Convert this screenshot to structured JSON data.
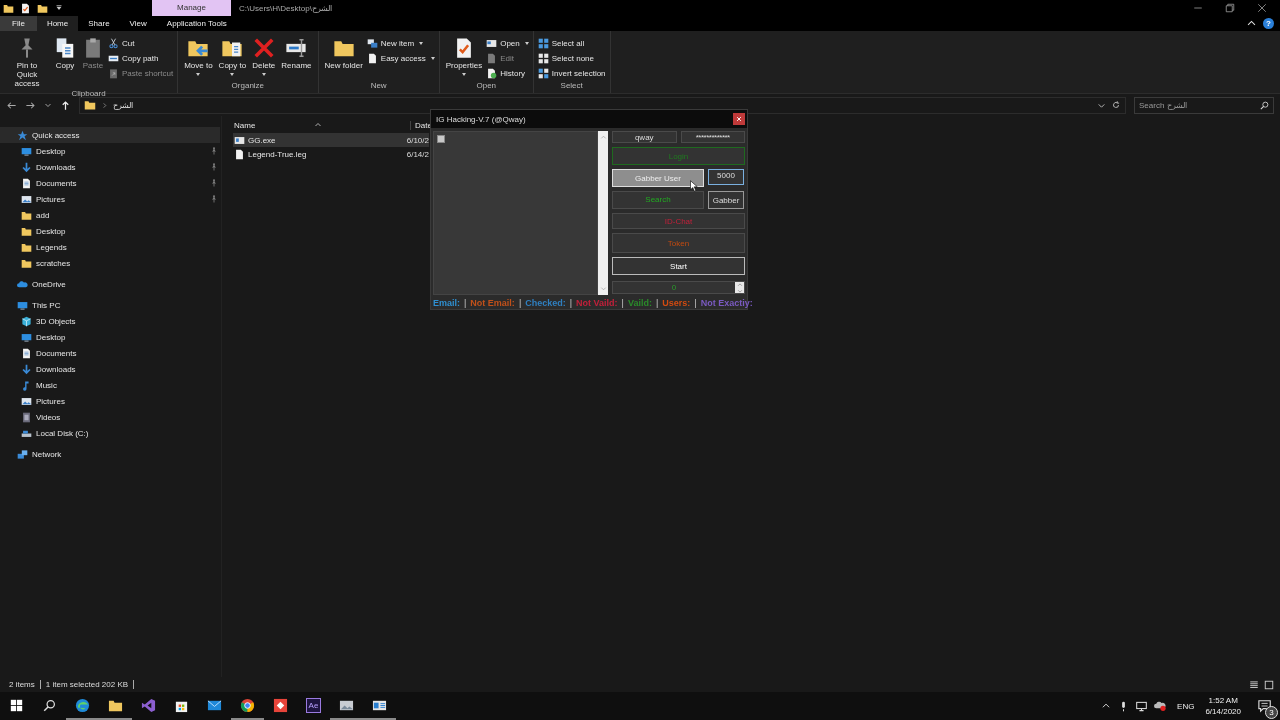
{
  "title_bar": {
    "context_tab": "Manage",
    "path": "C:\\Users\\H\\Desktop\\الشرح"
  },
  "ribbon_tabs": [
    {
      "label": "File",
      "kind": "file",
      "selected": false
    },
    {
      "label": "Home",
      "kind": "tab",
      "selected": true
    },
    {
      "label": "Share",
      "kind": "tab",
      "selected": false
    },
    {
      "label": "View",
      "kind": "tab",
      "selected": false
    },
    {
      "label": "Application Tools",
      "kind": "tab",
      "selected": false
    }
  ],
  "help": "?",
  "ribbon_groups": [
    {
      "label": "Clipboard",
      "large": [
        {
          "label": "Pin to Quick access",
          "dropdown": false,
          "disabled": false
        },
        {
          "label": "Copy",
          "dropdown": false,
          "disabled": false
        },
        {
          "label": "Paste",
          "dropdown": false,
          "disabled": true
        }
      ],
      "small": [
        {
          "label": "Cut",
          "dropdown": false,
          "disabled": false
        },
        {
          "label": "Copy path",
          "dropdown": false,
          "disabled": false
        },
        {
          "label": "Paste shortcut",
          "dropdown": false,
          "disabled": true
        }
      ]
    },
    {
      "label": "Organize",
      "large": [
        {
          "label": "Move to",
          "dropdown": true,
          "disabled": false
        },
        {
          "label": "Copy to",
          "dropdown": true,
          "disabled": false
        },
        {
          "label": "Delete",
          "dropdown": true,
          "disabled": false
        },
        {
          "label": "Rename",
          "dropdown": false,
          "disabled": false
        }
      ]
    },
    {
      "label": "New",
      "large": [
        {
          "label": "New folder",
          "dropdown": false,
          "disabled": false
        }
      ],
      "small": [
        {
          "label": "New item",
          "dropdown": true,
          "disabled": false
        },
        {
          "label": "Easy access",
          "dropdown": true,
          "disabled": false
        }
      ]
    },
    {
      "label": "Open",
      "large": [
        {
          "label": "Properties",
          "dropdown": true,
          "disabled": false
        }
      ],
      "small": [
        {
          "label": "Open",
          "dropdown": true,
          "disabled": false
        },
        {
          "label": "Edit",
          "dropdown": false,
          "disabled": true
        },
        {
          "label": "History",
          "dropdown": false,
          "disabled": false
        }
      ]
    },
    {
      "label": "Select",
      "small": [
        {
          "label": "Select all",
          "dropdown": false,
          "disabled": false
        },
        {
          "label": "Select none",
          "dropdown": false,
          "disabled": false
        },
        {
          "label": "Invert selection",
          "dropdown": false,
          "disabled": false
        }
      ]
    }
  ],
  "address": {
    "path": "الشرح"
  },
  "search": {
    "placeholder": "Search الشرح"
  },
  "nav": [
    {
      "label": "Quick access",
      "selected": true,
      "children": [
        {
          "label": "Desktop",
          "pinned": true
        },
        {
          "label": "Downloads",
          "pinned": true
        },
        {
          "label": "Documents",
          "pinned": true
        },
        {
          "label": "Pictures",
          "pinned": true
        },
        {
          "label": "add",
          "pinned": false
        },
        {
          "label": "Desktop",
          "pinned": false
        },
        {
          "label": "Legends",
          "pinned": false
        },
        {
          "label": "scratches",
          "pinned": false
        }
      ]
    },
    {
      "label": "OneDrive",
      "selected": false
    },
    {
      "label": "This PC",
      "selected": false,
      "children": [
        {
          "label": "3D Objects"
        },
        {
          "label": "Desktop"
        },
        {
          "label": "Documents"
        },
        {
          "label": "Downloads"
        },
        {
          "label": "Music"
        },
        {
          "label": "Pictures"
        },
        {
          "label": "Videos"
        },
        {
          "label": "Local Disk (C:)"
        }
      ]
    },
    {
      "label": "Network",
      "selected": false
    }
  ],
  "files": {
    "columns": [
      "Name",
      "Date"
    ],
    "rows": [
      {
        "name": "GG.exe",
        "date": "6/10/2",
        "selected": true
      },
      {
        "name": "Legend-True.leg",
        "date": "6/14/2",
        "selected": false
      }
    ]
  },
  "app_window": {
    "title": "IG Hacking-V.7 (@Qway)",
    "list_checked": false,
    "username": "qway",
    "password": "*************",
    "login": "Login",
    "grabber_user": {
      "label": "Gabber User",
      "highlighted": true
    },
    "count": "5000",
    "search": "Search",
    "gabber": "Gabber",
    "id_chat": "ID-Chat",
    "token": "Token",
    "start": "Start",
    "spinner": "0",
    "legend": [
      {
        "text": "Email:",
        "color": "#2f8fd0",
        "separator": "|"
      },
      {
        "text": "Not Email:",
        "color": "#c0501a",
        "separator": "|"
      },
      {
        "text": "Checked:",
        "color": "#2f7fc0",
        "separator": "|"
      },
      {
        "text": "Not Vaild:",
        "color": "#c0203a",
        "separator": "|"
      },
      {
        "text": "Vaild:",
        "color": "#2a8a2a",
        "separator": "|"
      },
      {
        "text": "Users:",
        "color": "#d04a10",
        "separator": "|"
      },
      {
        "text": "Not Exactiy:",
        "color": "#7a5ac0"
      }
    ]
  },
  "status_bar": {
    "item_count": "2 items",
    "selection": "1 item selected  202 KB"
  },
  "taskbar": {
    "apps": [
      {
        "running": true
      },
      {
        "running": true
      },
      {
        "running": false
      },
      {
        "running": false
      },
      {
        "running": false
      },
      {
        "running": true
      },
      {
        "running": false
      },
      {
        "label": "Ae",
        "running": false
      },
      {
        "running": true
      },
      {
        "running": true
      }
    ],
    "language": "ENG",
    "time": "1:52 AM",
    "date": "6/14/2020",
    "notifications": "3"
  }
}
